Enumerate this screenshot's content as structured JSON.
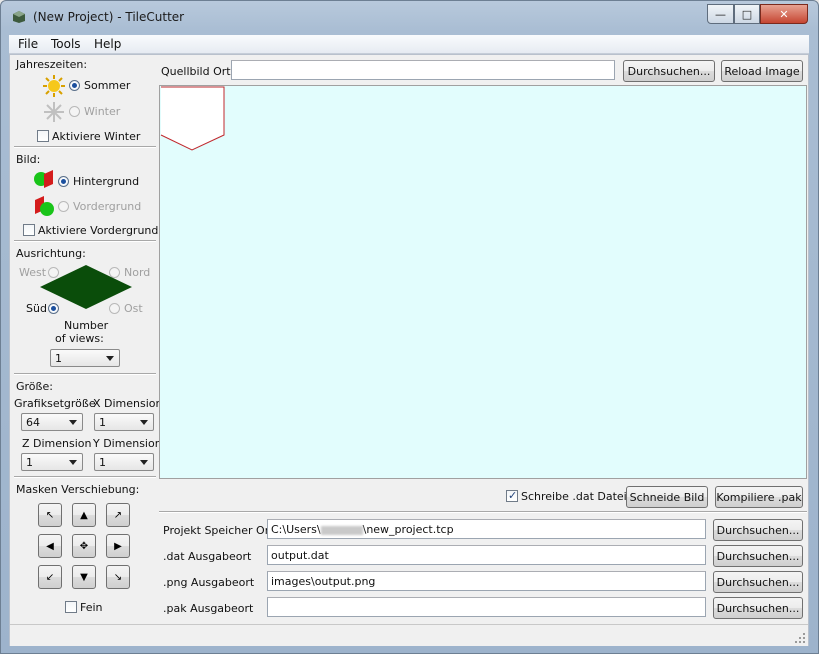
{
  "window": {
    "title": "(New Project) - TileCutter"
  },
  "menu": [
    "File",
    "Tools",
    "Help"
  ],
  "seasons": {
    "heading": "Jahreszeiten:",
    "summer": "Sommer",
    "winter": "Winter",
    "enable_winter": "Aktiviere Winter"
  },
  "image": {
    "heading": "Bild:",
    "background": "Hintergrund",
    "foreground": "Vordergrund",
    "enable_foreground": "Aktiviere Vordergrund"
  },
  "orientation": {
    "heading": "Ausrichtung:",
    "west": "West",
    "north": "Nord",
    "south": "Süd",
    "east": "Ost",
    "views_label_1": "Number",
    "views_label_2": "of views:",
    "views_value": "1"
  },
  "size": {
    "heading": "Größe:",
    "grafikset_label": "Grafiksetgröße",
    "grafikset_value": "64",
    "x_label": "X Dimension",
    "x_value": "1",
    "z_label": "Z Dimension",
    "z_value": "1",
    "y_label": "Y Dimension",
    "y_value": "1"
  },
  "mask": {
    "heading": "Masken Verschiebung:",
    "fine": "Fein"
  },
  "source": {
    "label": "Quellbild Ort:",
    "value": "",
    "browse": "Durchsuchen...",
    "reload": "Reload Image"
  },
  "actions": {
    "write_dat": "Schreibe .dat Datei",
    "cut": "Schneide Bild",
    "compile": "Kompiliere .pak"
  },
  "paths": [
    {
      "label": "Projekt Speicher Ort",
      "value_prefix": "C:\\Users\\",
      "value_suffix": "\\new_project.tcp",
      "button": "Durchsuchen..."
    },
    {
      "label": ".dat Ausgabeort",
      "value": "output.dat",
      "button": "Durchsuchen..."
    },
    {
      "label": ".png Ausgabeort",
      "value": "images\\output.png",
      "button": "Durchsuchen..."
    },
    {
      "label": ".pak Ausgabeort",
      "value": "",
      "button": "Durchsuchen..."
    }
  ],
  "colors": {
    "canvas_bg": "#e2fdfd",
    "tile_outline": "#c0282d",
    "diamond": "#0a4d0a"
  }
}
